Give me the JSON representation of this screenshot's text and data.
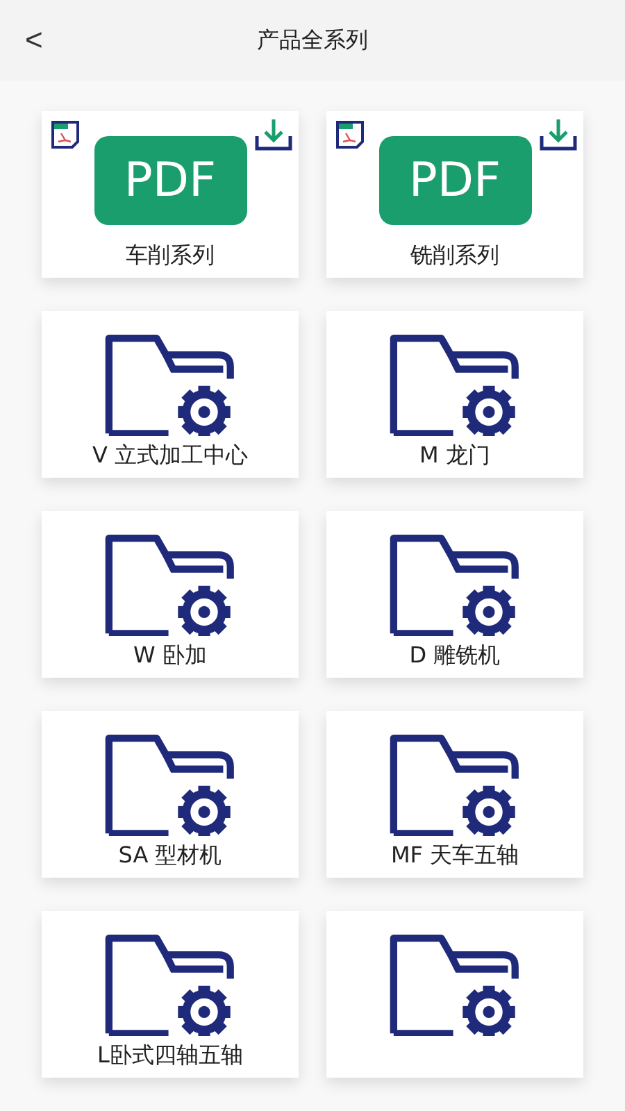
{
  "header": {
    "back_icon": "<",
    "title": "产品全系列"
  },
  "items": [
    {
      "kind": "pdf",
      "badge": "PDF",
      "label": "车削系列"
    },
    {
      "kind": "pdf",
      "badge": "PDF",
      "label": "铣削系列"
    },
    {
      "kind": "folder",
      "label": "V 立式加工中心"
    },
    {
      "kind": "folder",
      "label": "M 龙门"
    },
    {
      "kind": "folder",
      "label": "W 卧加"
    },
    {
      "kind": "folder",
      "label": "D 雕铣机"
    },
    {
      "kind": "folder",
      "label": "SA 型材机"
    },
    {
      "kind": "folder",
      "label": "MF 天车五轴"
    },
    {
      "kind": "folder",
      "label": "L卧式四轴五轴"
    },
    {
      "kind": "folder"
    }
  ]
}
